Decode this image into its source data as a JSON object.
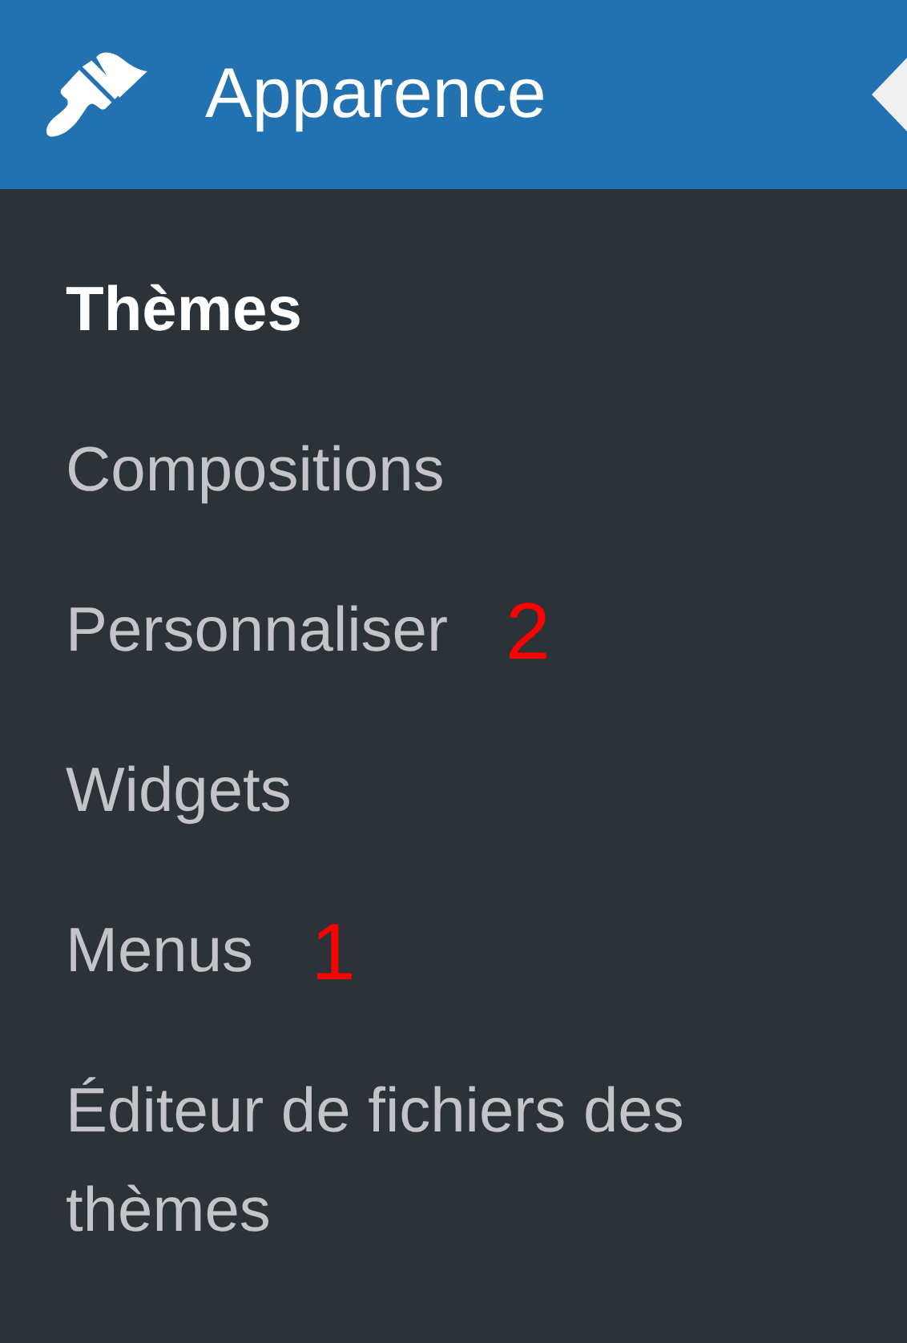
{
  "menu": {
    "title": "Apparence",
    "current": true
  },
  "submenu": [
    {
      "label": "Thèmes",
      "selected": true
    },
    {
      "label": "Compositions",
      "selected": false
    },
    {
      "label": "Personnaliser",
      "selected": false,
      "annotation": "2"
    },
    {
      "label": "Widgets",
      "selected": false
    },
    {
      "label": "Menus",
      "selected": false,
      "annotation": "1"
    },
    {
      "label": "Éditeur de fichiers des thèmes",
      "selected": false
    }
  ]
}
